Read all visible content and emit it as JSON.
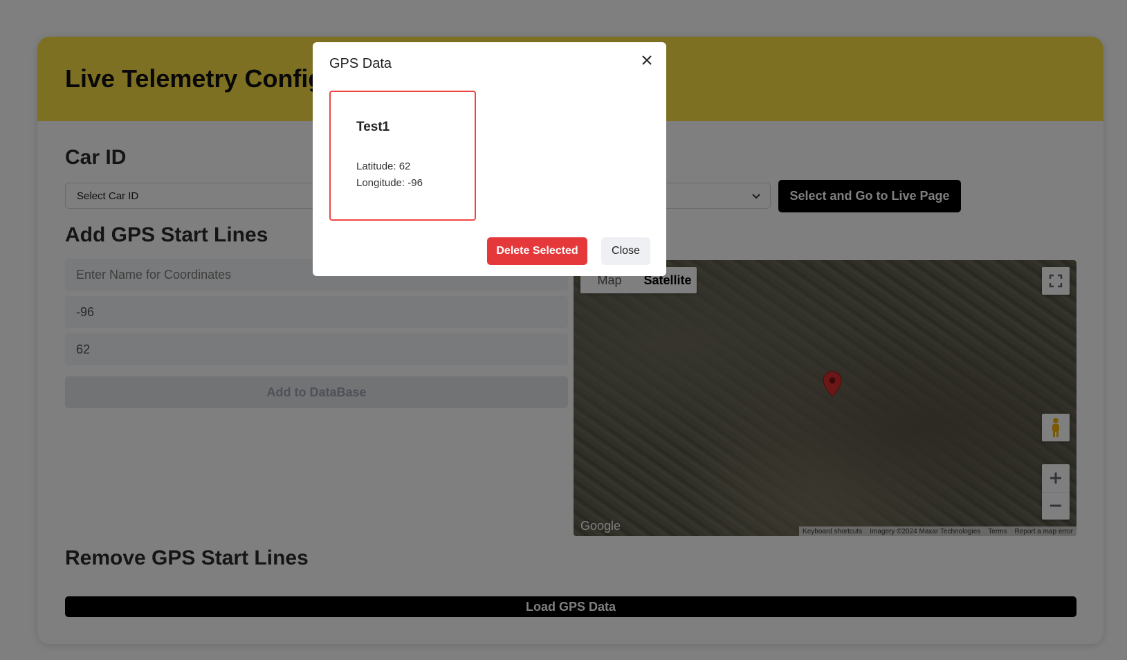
{
  "page": {
    "title": "Live Telemetry Configuration",
    "accent_color": "#fde047"
  },
  "car_id": {
    "heading": "Car ID",
    "select_value": "Select Car ID",
    "go_button": "Select and Go to Live Page"
  },
  "add_gps": {
    "heading": "Add GPS Start Lines",
    "name_placeholder": "Enter Name for Coordinates",
    "longitude_value": "-96",
    "latitude_value": "62",
    "add_button": "Add to DataBase"
  },
  "map": {
    "map_tab": "Map",
    "satellite_tab": "Satellite",
    "selected_type": "Satellite",
    "logo": "Google",
    "attribution": [
      "Keyboard shortcuts",
      "Imagery ©2024 Maxar Technologies",
      "Terms",
      "Report a map error"
    ],
    "pin_color": "#d32f2f"
  },
  "remove_gps": {
    "heading": "Remove GPS Start Lines",
    "load_button": "Load GPS Data"
  },
  "modal": {
    "title": "GPS Data",
    "cards": [
      {
        "name": "Test1",
        "latitude": "Latitude: 62",
        "longitude": "Longitude: -96",
        "selected": true
      }
    ],
    "delete_button": "Delete Selected",
    "close_button": "Close",
    "delete_color": "#e5383b"
  }
}
